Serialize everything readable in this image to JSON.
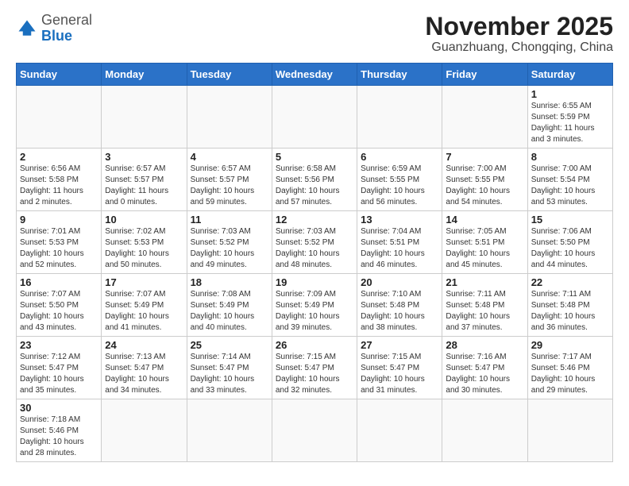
{
  "header": {
    "logo_general": "General",
    "logo_blue": "Blue",
    "month_year": "November 2025",
    "location": "Guanzhuang, Chongqing, China"
  },
  "weekdays": [
    "Sunday",
    "Monday",
    "Tuesday",
    "Wednesday",
    "Thursday",
    "Friday",
    "Saturday"
  ],
  "weeks": [
    [
      {
        "day": "",
        "info": ""
      },
      {
        "day": "",
        "info": ""
      },
      {
        "day": "",
        "info": ""
      },
      {
        "day": "",
        "info": ""
      },
      {
        "day": "",
        "info": ""
      },
      {
        "day": "",
        "info": ""
      },
      {
        "day": "1",
        "info": "Sunrise: 6:55 AM\nSunset: 5:59 PM\nDaylight: 11 hours\nand 3 minutes."
      }
    ],
    [
      {
        "day": "2",
        "info": "Sunrise: 6:56 AM\nSunset: 5:58 PM\nDaylight: 11 hours\nand 2 minutes."
      },
      {
        "day": "3",
        "info": "Sunrise: 6:57 AM\nSunset: 5:57 PM\nDaylight: 11 hours\nand 0 minutes."
      },
      {
        "day": "4",
        "info": "Sunrise: 6:57 AM\nSunset: 5:57 PM\nDaylight: 10 hours\nand 59 minutes."
      },
      {
        "day": "5",
        "info": "Sunrise: 6:58 AM\nSunset: 5:56 PM\nDaylight: 10 hours\nand 57 minutes."
      },
      {
        "day": "6",
        "info": "Sunrise: 6:59 AM\nSunset: 5:55 PM\nDaylight: 10 hours\nand 56 minutes."
      },
      {
        "day": "7",
        "info": "Sunrise: 7:00 AM\nSunset: 5:55 PM\nDaylight: 10 hours\nand 54 minutes."
      },
      {
        "day": "8",
        "info": "Sunrise: 7:00 AM\nSunset: 5:54 PM\nDaylight: 10 hours\nand 53 minutes."
      }
    ],
    [
      {
        "day": "9",
        "info": "Sunrise: 7:01 AM\nSunset: 5:53 PM\nDaylight: 10 hours\nand 52 minutes."
      },
      {
        "day": "10",
        "info": "Sunrise: 7:02 AM\nSunset: 5:53 PM\nDaylight: 10 hours\nand 50 minutes."
      },
      {
        "day": "11",
        "info": "Sunrise: 7:03 AM\nSunset: 5:52 PM\nDaylight: 10 hours\nand 49 minutes."
      },
      {
        "day": "12",
        "info": "Sunrise: 7:03 AM\nSunset: 5:52 PM\nDaylight: 10 hours\nand 48 minutes."
      },
      {
        "day": "13",
        "info": "Sunrise: 7:04 AM\nSunset: 5:51 PM\nDaylight: 10 hours\nand 46 minutes."
      },
      {
        "day": "14",
        "info": "Sunrise: 7:05 AM\nSunset: 5:51 PM\nDaylight: 10 hours\nand 45 minutes."
      },
      {
        "day": "15",
        "info": "Sunrise: 7:06 AM\nSunset: 5:50 PM\nDaylight: 10 hours\nand 44 minutes."
      }
    ],
    [
      {
        "day": "16",
        "info": "Sunrise: 7:07 AM\nSunset: 5:50 PM\nDaylight: 10 hours\nand 43 minutes."
      },
      {
        "day": "17",
        "info": "Sunrise: 7:07 AM\nSunset: 5:49 PM\nDaylight: 10 hours\nand 41 minutes."
      },
      {
        "day": "18",
        "info": "Sunrise: 7:08 AM\nSunset: 5:49 PM\nDaylight: 10 hours\nand 40 minutes."
      },
      {
        "day": "19",
        "info": "Sunrise: 7:09 AM\nSunset: 5:49 PM\nDaylight: 10 hours\nand 39 minutes."
      },
      {
        "day": "20",
        "info": "Sunrise: 7:10 AM\nSunset: 5:48 PM\nDaylight: 10 hours\nand 38 minutes."
      },
      {
        "day": "21",
        "info": "Sunrise: 7:11 AM\nSunset: 5:48 PM\nDaylight: 10 hours\nand 37 minutes."
      },
      {
        "day": "22",
        "info": "Sunrise: 7:11 AM\nSunset: 5:48 PM\nDaylight: 10 hours\nand 36 minutes."
      }
    ],
    [
      {
        "day": "23",
        "info": "Sunrise: 7:12 AM\nSunset: 5:47 PM\nDaylight: 10 hours\nand 35 minutes."
      },
      {
        "day": "24",
        "info": "Sunrise: 7:13 AM\nSunset: 5:47 PM\nDaylight: 10 hours\nand 34 minutes."
      },
      {
        "day": "25",
        "info": "Sunrise: 7:14 AM\nSunset: 5:47 PM\nDaylight: 10 hours\nand 33 minutes."
      },
      {
        "day": "26",
        "info": "Sunrise: 7:15 AM\nSunset: 5:47 PM\nDaylight: 10 hours\nand 32 minutes."
      },
      {
        "day": "27",
        "info": "Sunrise: 7:15 AM\nSunset: 5:47 PM\nDaylight: 10 hours\nand 31 minutes."
      },
      {
        "day": "28",
        "info": "Sunrise: 7:16 AM\nSunset: 5:47 PM\nDaylight: 10 hours\nand 30 minutes."
      },
      {
        "day": "29",
        "info": "Sunrise: 7:17 AM\nSunset: 5:46 PM\nDaylight: 10 hours\nand 29 minutes."
      }
    ],
    [
      {
        "day": "30",
        "info": "Sunrise: 7:18 AM\nSunset: 5:46 PM\nDaylight: 10 hours\nand 28 minutes."
      },
      {
        "day": "",
        "info": ""
      },
      {
        "day": "",
        "info": ""
      },
      {
        "day": "",
        "info": ""
      },
      {
        "day": "",
        "info": ""
      },
      {
        "day": "",
        "info": ""
      },
      {
        "day": "",
        "info": ""
      }
    ]
  ]
}
